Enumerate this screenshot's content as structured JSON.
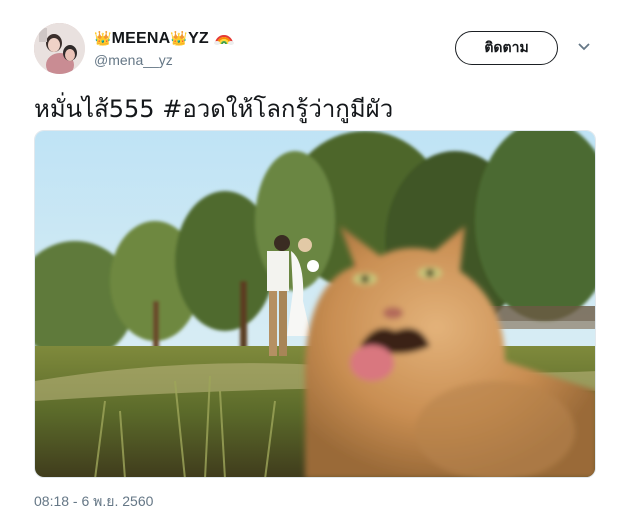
{
  "user": {
    "display_name_part1": "MEENA",
    "display_name_part2": "YZ",
    "crown_icon": "👑",
    "handle": "@mena__yz",
    "avatar": "avatar-photo"
  },
  "actions": {
    "follow_label": "ติดตาม",
    "menu_icon": "chevron-down-icon"
  },
  "tweet": {
    "text": "หมั่นไส้555 #อวดให้โลกรู้ว่ากูมีผัว",
    "image": "cat-photobombing-wedding-couple-photo",
    "timestamp": "08:18 - 6 พ.ย. 2560"
  },
  "colors": {
    "text_primary": "#14171a",
    "text_secondary": "#657786",
    "border": "#e1e8ed"
  }
}
